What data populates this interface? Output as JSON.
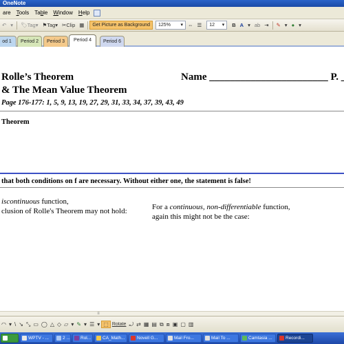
{
  "window": {
    "title": "OneNote"
  },
  "menubar": {
    "items": [
      "are",
      "Tools",
      "Table",
      "Window",
      "Help"
    ],
    "underline": [
      "",
      "T",
      "b",
      "W",
      "H"
    ]
  },
  "toolbar": {
    "tag": "Tag",
    "tag2": "Tag",
    "clip": "Clip",
    "bg_button": "Get Picture as Background",
    "zoom": "125%",
    "font_size": "12"
  },
  "tabs": [
    {
      "label": "od 1"
    },
    {
      "label": "Period 2"
    },
    {
      "label": "Period 3"
    },
    {
      "label": "Period 4"
    },
    {
      "label": "Period 6"
    }
  ],
  "active_tab": "Period 4",
  "page": {
    "title_line1": "Rolle’s Theorem",
    "title_line2": "& The Mean Value Theorem",
    "name_label": "Name _______________________ P. _",
    "assignment": "Page 176-177: 1, 5, 9, 13, 19, 27, 29, 31, 33, 34, 37, 39, 43, 49",
    "section_heading": "Theorem",
    "statement": "that both conditions on f are necessary. Without either one, the statement is false!",
    "left_col": {
      "line1_italic": "iscontinuous",
      "line1_rest": " function,",
      "line2": "clusion of Rolle's Theorem may not hold:"
    },
    "right_col": {
      "line1_a": "For a ",
      "line1_b": "continuous, non-differentiable",
      "line1_c": " function,",
      "line2": "again this might not be the case:"
    }
  },
  "drawing_toolbar": {
    "rotate": "Rotate"
  },
  "taskbar": {
    "items": [
      {
        "label": "WPTV - ...",
        "active": false
      },
      {
        "label": "2 ...",
        "active": false
      },
      {
        "label": "Rol...",
        "active": false
      },
      {
        "label": "CA_Math...",
        "active": false
      },
      {
        "label": "Novell G...",
        "active": false
      },
      {
        "label": "Mail Fro...",
        "active": false
      },
      {
        "label": "Mail To ...",
        "active": false
      },
      {
        "label": "Camtasia ...",
        "active": false
      },
      {
        "label": "Recordi...",
        "active": true
      }
    ]
  },
  "colors": {
    "titlebar": "#1b4aa6",
    "chrome": "#ece9d8",
    "accent_button": "#f6c36a",
    "tab_period3": "#f4c98a",
    "tab_period4": "#ffffff",
    "rule_blue": "#3b4fc4",
    "taskbar": "#245edb"
  }
}
